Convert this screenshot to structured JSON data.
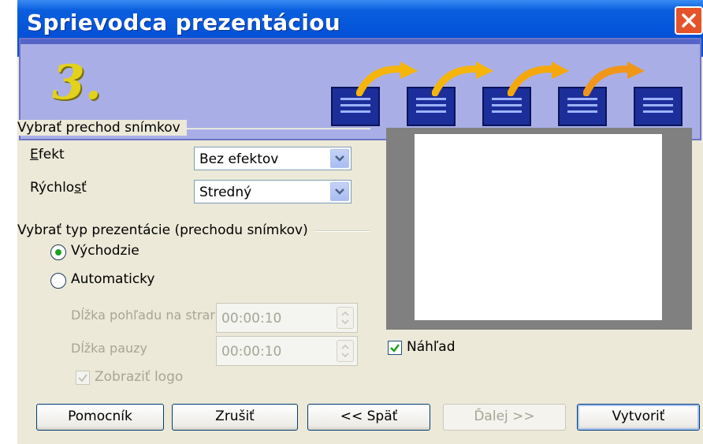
{
  "window": {
    "title": "Sprievodca prezentáciou"
  },
  "banner": {
    "step": "3."
  },
  "transition_group": {
    "label": "Vybrať prechod snímkov",
    "effect": {
      "label": "Efekt",
      "value": "Bez efektov"
    },
    "speed": {
      "label": "Rýchlosť",
      "value": "Stredný"
    }
  },
  "type_group": {
    "label": "Vybrať typ prezentácie (prechodu snímkov)",
    "default_option": {
      "label": "Východzie",
      "selected": true
    },
    "auto_option": {
      "label": "Automaticky",
      "selected": false
    },
    "page_duration": {
      "label": "Dĺžka pohľadu na strar",
      "value": "00:00:10"
    },
    "pause_duration": {
      "label": "Dĺžka pauzy",
      "value": "00:00:10"
    },
    "show_logo": {
      "label": "Zobraziť logo",
      "checked": true
    }
  },
  "preview": {
    "checkbox_label": "Náhľad",
    "checked": true
  },
  "buttons": {
    "help": "Pomocník",
    "cancel": "Zrušiť",
    "back": "<< Späť",
    "next": "Ďalej >>",
    "create": "Vytvoriť"
  },
  "colors": {
    "title_bar": "#0552d8",
    "banner": "#a9afe6",
    "dialog_bg": "#ece9d8",
    "arrow": "#f5b50b"
  }
}
